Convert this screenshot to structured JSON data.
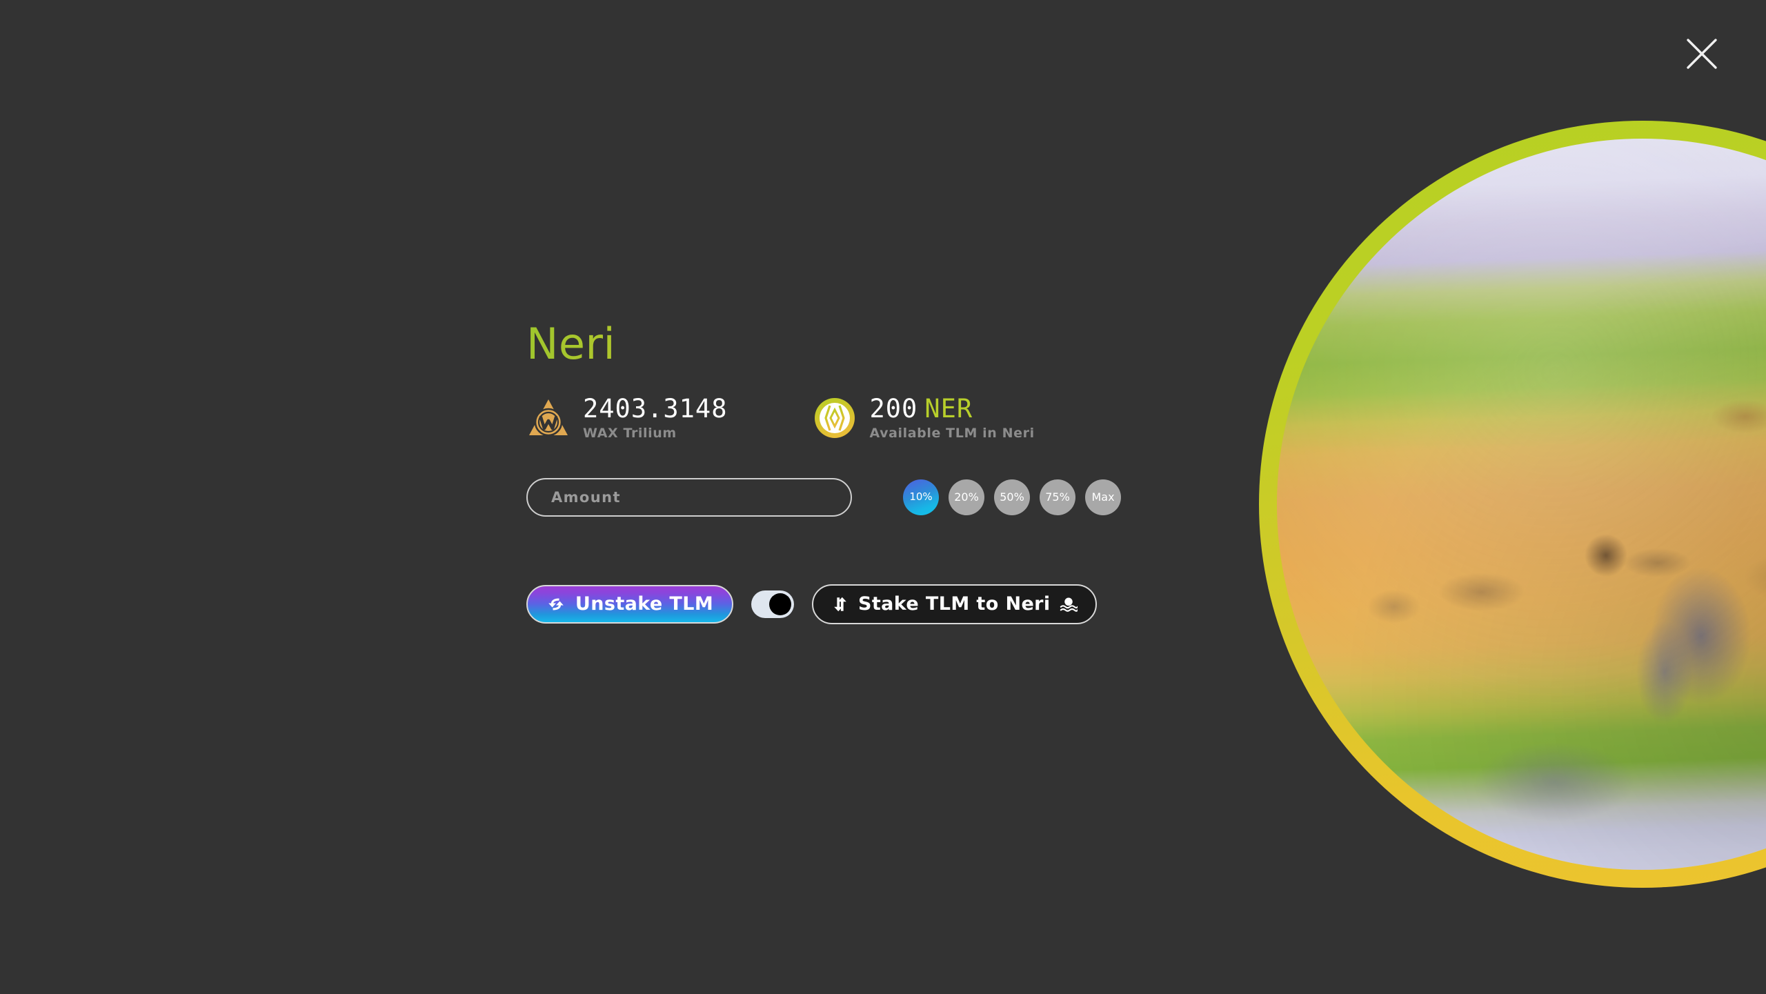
{
  "modal": {
    "close_label": "Close",
    "close_icon": "close-x-icon"
  },
  "planet": {
    "name": "Neri",
    "image_alt": "neri-planet-image",
    "ring_color_top": "#b7d023",
    "ring_color_bottom": "#edc430"
  },
  "title": "Neri",
  "title_gradient_start": "#9ec62d",
  "title_gradient_end": "#f0b544",
  "balances": [
    {
      "icon": "wax-token-icon",
      "amount": "2403.3148",
      "unit": "",
      "label": "WAX Trilium"
    },
    {
      "icon": "ner-token-icon",
      "amount": "200",
      "unit": "NER",
      "label": "Available TLM in Neri"
    }
  ],
  "amount_field": {
    "placeholder": "Amount",
    "value": ""
  },
  "percent_buttons": [
    {
      "label": "10%",
      "active": true
    },
    {
      "label": "20%",
      "active": false
    },
    {
      "label": "50%",
      "active": false
    },
    {
      "label": "75%",
      "active": false
    },
    {
      "label": "Max",
      "active": false
    }
  ],
  "actions": {
    "unstake_label": "Unstake TLM",
    "unstake_icon": "swap-vertical-icon",
    "unstake_gradient_start": "#9b3fd6",
    "unstake_gradient_end": "#17b7e9",
    "toggle": {
      "name": "stake-mode-toggle",
      "state": "on"
    },
    "stake_label": "Stake TLM to Neri",
    "stake_icon": "swap-vertical-icon",
    "stake_trailing_icon": "planet-sunset-icon"
  },
  "theme": {
    "background": "#333333",
    "accent_green": "#b8cf2b",
    "accent_cyan": "#12c3ea",
    "muted_text": "#8c8c8c"
  }
}
